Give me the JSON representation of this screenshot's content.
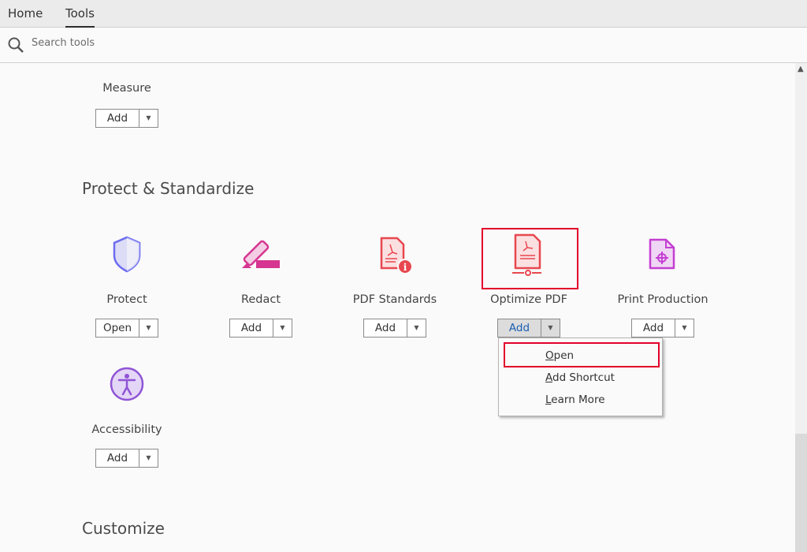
{
  "tabs": [
    {
      "label": "Home"
    },
    {
      "label": "Tools",
      "active": true
    }
  ],
  "search": {
    "placeholder": "Search tools"
  },
  "measure": {
    "label": "Measure",
    "button": "Add"
  },
  "sections": {
    "protect": "Protect & Standardize",
    "customize": "Customize"
  },
  "tools": [
    {
      "label": "Protect",
      "button": "Open",
      "icon": "shield-icon"
    },
    {
      "label": "Redact",
      "button": "Add",
      "icon": "redact-marker-icon"
    },
    {
      "label": "PDF Standards",
      "button": "Add",
      "icon": "pdf-standards-icon"
    },
    {
      "label": "Optimize PDF",
      "button": "Add",
      "icon": "optimize-pdf-icon"
    },
    {
      "label": "Print Production",
      "button": "Add",
      "icon": "print-production-icon"
    },
    {
      "label": "Accessibility",
      "button": "Add",
      "icon": "accessibility-icon"
    }
  ],
  "menu": {
    "items": [
      {
        "label": "Open",
        "key": "O",
        "rest": "pen"
      },
      {
        "label": "Add Shortcut",
        "key": "A",
        "rest": "dd Shortcut"
      },
      {
        "label": "Learn More",
        "key": "L",
        "rest": "earn More"
      }
    ]
  },
  "colors": {
    "highlight": "#e3002b",
    "protect": "#6b6bf0",
    "redact": "#d63591",
    "pdf": "#e8474f",
    "print": "#c43fd1",
    "access": "#9055d6"
  }
}
